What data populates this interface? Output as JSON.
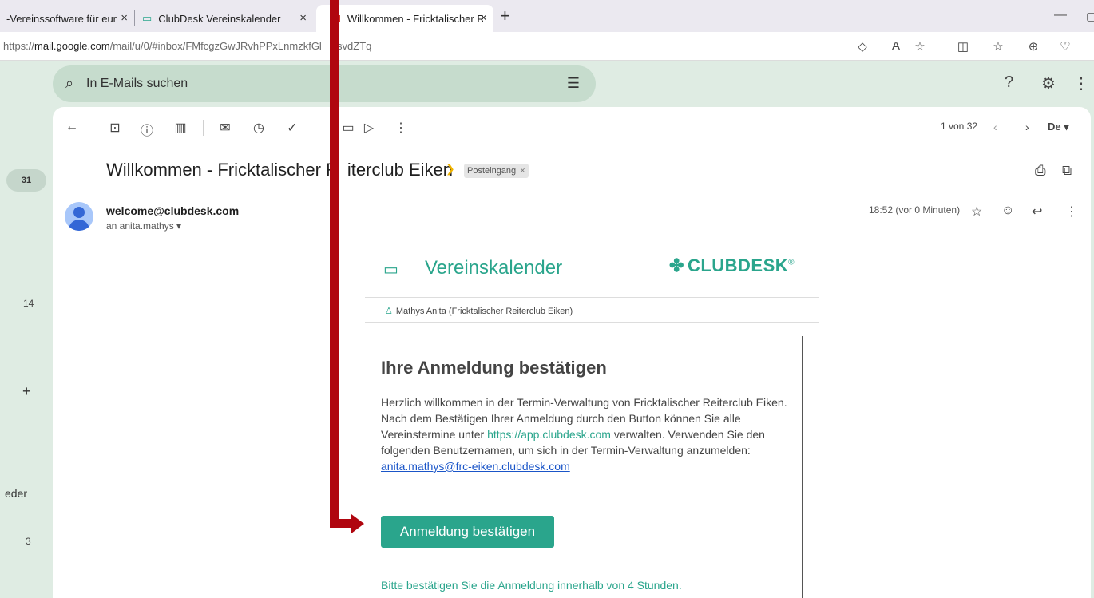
{
  "browser": {
    "tabs": [
      {
        "title": "-Vereinssoftware für eure V",
        "active": false
      },
      {
        "title": "ClubDesk Vereinskalender",
        "active": false
      },
      {
        "title": "Willkommen - Fricktalischer Reite",
        "active": true
      }
    ],
    "tab_close": "×",
    "new_tab": "+",
    "url_prefix": "https://",
    "url_host": "mail.google.com",
    "url_path": "/mail/u/0/#inbox/FMfcgzGwJRvhPPxLnmzkfGl",
    "url_tail": "qsvdZTq"
  },
  "gmail": {
    "search_placeholder": "In E-Mails suchen",
    "pager": "1 von 32",
    "language_badge": "De",
    "left_rail": {
      "badge": "31",
      "label_14": "14",
      "plus": "+",
      "partial_label": "eder",
      "label_3": "3"
    },
    "message": {
      "subject_part1": "Willkommen - Fricktalischer R",
      "subject_part2": "iterclub Eiken",
      "label_chip": "Posteingang",
      "chip_close": "×",
      "sender": "welcome@clubdesk.com",
      "recipient": "an anita.mathys",
      "timestamp": "18:52 (vor 0 Minuten)"
    }
  },
  "email": {
    "brand_title": "Vereinskalender",
    "logo_text": "CLUBDESK",
    "logo_mark": "®",
    "user_line": "Mathys Anita (Fricktalischer Reiterclub Eiken)",
    "heading": "Ihre Anmeldung bestätigen",
    "para_part1": "Herzlich willkommen in der Termin-Verwaltung von Fricktalischer Reiterclub Eiken. Nach dem Bestätigen Ihrer Anmeldung durch den Button können Sie alle Vereinstermine unter ",
    "para_link": "https://app.clubdesk.com",
    "para_part2": " verwalten. Verwenden Sie den folgenden Benutzernamen, um sich in der Termin-Verwaltung anzumelden:",
    "username": "anita.mathys@frc-eiken.clubdesk.com",
    "cta_label": "Anmeldung bestätigen",
    "footnote": "Bitte bestätigen Sie die Anmeldung innerhalb von 4 Stunden."
  },
  "colors": {
    "brand_teal": "#2aa58c",
    "annotation_red": "#b0060f",
    "gmail_bg": "#dfece3"
  }
}
